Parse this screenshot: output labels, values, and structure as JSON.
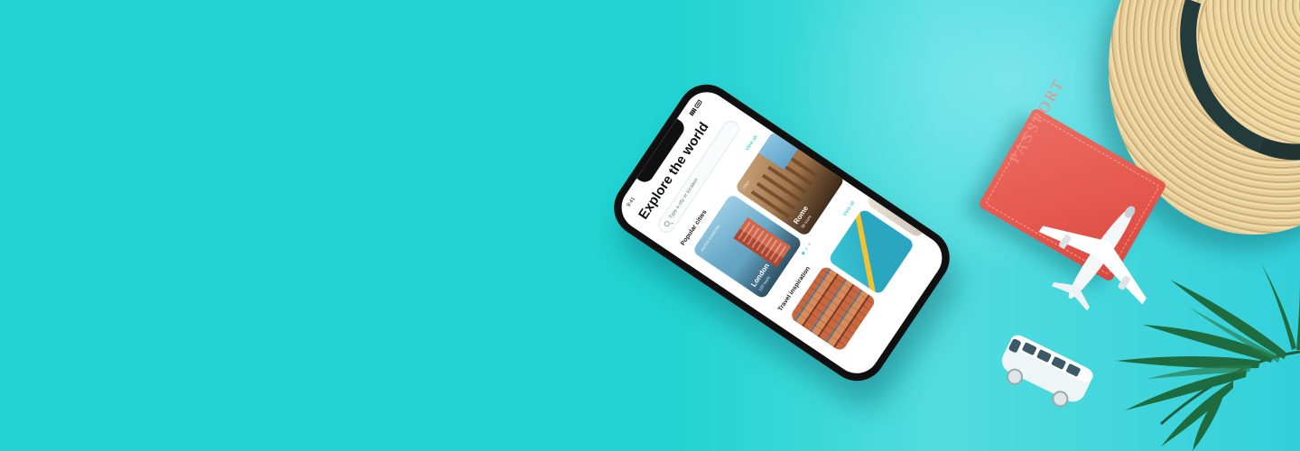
{
  "banner": {
    "background_color": "#21d3d2",
    "accent_color": "#21c7c8"
  },
  "phone": {
    "status_time": "9:41",
    "app_title": "Explore the world",
    "search": {
      "placeholder": "Type a city or location"
    },
    "popular": {
      "title": "Popular cities",
      "view_all": "View all"
    },
    "cities": [
      {
        "badge": "UNITED KINGDOM",
        "name": "London",
        "sub": "120 tours"
      },
      {
        "badge": "ITALY",
        "name": "Rome",
        "sub": "90 tours"
      }
    ],
    "inspiration": {
      "title": "Travel inspiration",
      "view_all": "View all"
    }
  },
  "props": {
    "passport_label": "PASSPORT",
    "icons": [
      "passport-icon",
      "straw-hat-icon",
      "airplane-icon",
      "bus-icon",
      "palm-leaf-icon"
    ]
  }
}
